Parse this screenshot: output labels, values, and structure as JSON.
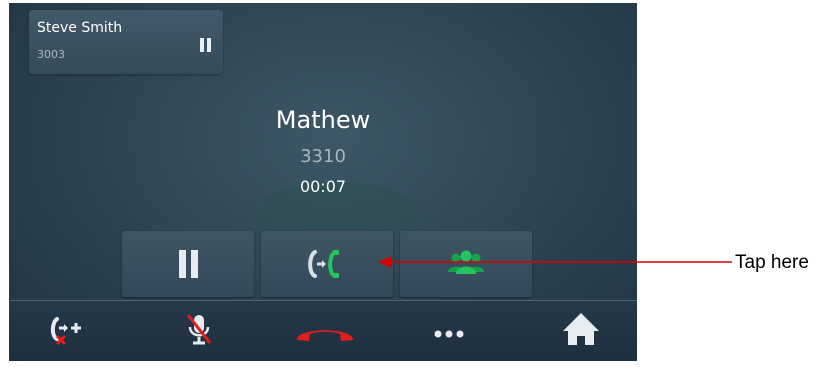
{
  "held_call": {
    "name": "Steve Smith",
    "number": "3003",
    "state_icon": "pause-icon"
  },
  "active_call": {
    "name": "Mathew",
    "number": "3310",
    "timer": "00:07"
  },
  "actions": [
    {
      "icon": "pause-icon"
    },
    {
      "icon": "swap-calls-icon"
    },
    {
      "icon": "conference-icon"
    }
  ],
  "bottom_bar": [
    {
      "icon": "transfer-add-icon"
    },
    {
      "icon": "mute-microphone-icon"
    },
    {
      "icon": "end-call-icon"
    },
    {
      "icon": "more-icon"
    },
    {
      "icon": "home-icon"
    }
  ],
  "annotation": {
    "label": "Tap here"
  },
  "colors": {
    "accent_green": "#22c55e",
    "end_call_red": "#e11d1d",
    "annotation_red": "#d90000"
  }
}
